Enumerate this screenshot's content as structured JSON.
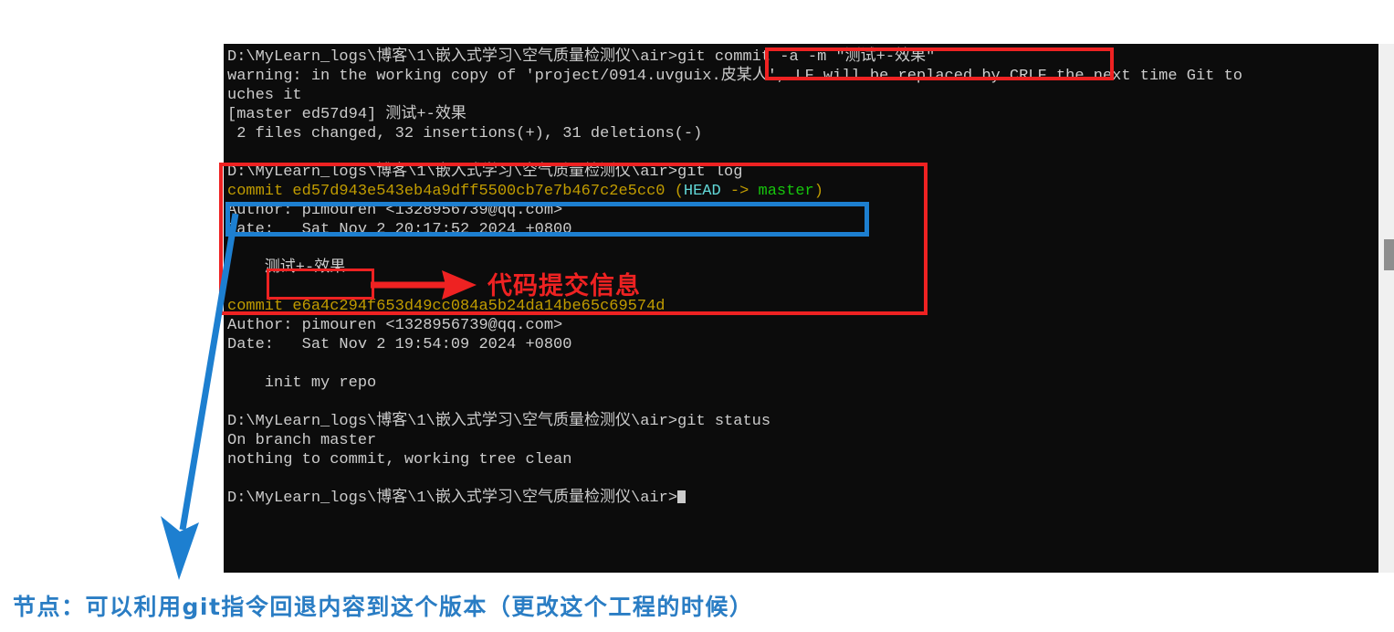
{
  "terminal": {
    "background_color": "#0c0c0c",
    "foreground_color": "#cccccc",
    "prompt_path": "D:\\MyLearn_logs\\博客\\1\\嵌入式学习\\空气质量检测仪\\air>",
    "lines": [
      {
        "id": "l1-prompt",
        "segments": [
          {
            "text": "D:\\MyLearn_logs\\博客\\1\\嵌入式学习\\空气质量检测仪\\air>git commit -a -m \"测试+-效果\"",
            "color": "white"
          }
        ]
      },
      {
        "id": "l2-warning",
        "segments": [
          {
            "text": "warning: in the working copy of 'project/0914.uvguix.皮某人', LF will be replaced by CRLF the next time Git to",
            "color": "white"
          }
        ]
      },
      {
        "id": "l3-warning-wrap",
        "segments": [
          {
            "text": "uches it",
            "color": "white"
          }
        ]
      },
      {
        "id": "l4-commit-out",
        "segments": [
          {
            "text": "[master ed57d94] 测试+-效果",
            "color": "white"
          }
        ]
      },
      {
        "id": "l5-stat",
        "segments": [
          {
            "text": " 2 files changed, 32 insertions(+), 31 deletions(-)",
            "color": "white"
          }
        ]
      },
      {
        "id": "l6-blank",
        "segments": [
          {
            "text": " ",
            "color": "white"
          }
        ]
      },
      {
        "id": "l7-prompt-log",
        "segments": [
          {
            "text": "D:\\MyLearn_logs\\博客\\1\\嵌入式学习\\空气质量检测仪\\air>git log",
            "color": "white"
          }
        ]
      },
      {
        "id": "l8-commit1",
        "segments": [
          {
            "text": "commit ed57d943e543eb4a9dff5500cb7e7b467c2e5cc0 ",
            "color": "yellow"
          },
          {
            "text": "(",
            "color": "yellow"
          },
          {
            "text": "HEAD",
            "color": "cyan2"
          },
          {
            "text": " -> ",
            "color": "yellow"
          },
          {
            "text": "master",
            "color": "green"
          },
          {
            "text": ")",
            "color": "yellow"
          }
        ]
      },
      {
        "id": "l9-author1",
        "segments": [
          {
            "text": "Author: pimouren <1328956739@qq.com>",
            "color": "white"
          }
        ]
      },
      {
        "id": "l10-date1",
        "segments": [
          {
            "text": "Date:   Sat Nov 2 20:17:52 2024 +0800",
            "color": "white"
          }
        ]
      },
      {
        "id": "l11-blank",
        "segments": [
          {
            "text": " ",
            "color": "white"
          }
        ]
      },
      {
        "id": "l12-msg1",
        "segments": [
          {
            "text": "    测试+-效果",
            "color": "white"
          }
        ]
      },
      {
        "id": "l13-blank",
        "segments": [
          {
            "text": " ",
            "color": "white"
          }
        ]
      },
      {
        "id": "l14-commit2",
        "segments": [
          {
            "text": "commit e6a4c294f653d49cc084a5b24da14be65c69574d",
            "color": "yellow"
          }
        ]
      },
      {
        "id": "l15-author2",
        "segments": [
          {
            "text": "Author: pimouren <1328956739@qq.com>",
            "color": "white"
          }
        ]
      },
      {
        "id": "l16-date2",
        "segments": [
          {
            "text": "Date:   Sat Nov 2 19:54:09 2024 +0800",
            "color": "white"
          }
        ]
      },
      {
        "id": "l17-blank",
        "segments": [
          {
            "text": " ",
            "color": "white"
          }
        ]
      },
      {
        "id": "l18-msg2",
        "segments": [
          {
            "text": "    init my repo",
            "color": "white"
          }
        ]
      },
      {
        "id": "l19-blank",
        "segments": [
          {
            "text": " ",
            "color": "white"
          }
        ]
      },
      {
        "id": "l20-prompt-st",
        "segments": [
          {
            "text": "D:\\MyLearn_logs\\博客\\1\\嵌入式学习\\空气质量检测仪\\air>git status",
            "color": "white"
          }
        ]
      },
      {
        "id": "l21-branch",
        "segments": [
          {
            "text": "On branch master",
            "color": "white"
          }
        ]
      },
      {
        "id": "l22-clean",
        "segments": [
          {
            "text": "nothing to commit, working tree clean",
            "color": "white"
          }
        ]
      },
      {
        "id": "l23-blank",
        "segments": [
          {
            "text": " ",
            "color": "white"
          }
        ]
      },
      {
        "id": "l24-prompt-end",
        "segments": [
          {
            "text": "D:\\MyLearn_logs\\博客\\1\\嵌入式学习\\空气质量检测仪\\air>",
            "color": "white"
          },
          {
            "text": "CURSOR",
            "color": "cursor"
          }
        ]
      }
    ]
  },
  "annotations": {
    "red_color": "#ee2222",
    "blue_color": "#1d7fd0",
    "code_commit_info_label": "代码提交信息",
    "commit_message_box_text": "测试+-效果",
    "caption": "节点：可以利用git指令回退内容到这个版本（更改这个工程的时候）"
  }
}
